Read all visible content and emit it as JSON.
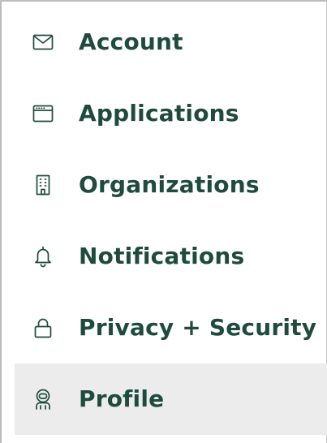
{
  "menu": {
    "items": [
      {
        "label": "Account",
        "icon": "mail-icon",
        "active": false
      },
      {
        "label": "Applications",
        "icon": "browser-window-icon",
        "active": false
      },
      {
        "label": "Organizations",
        "icon": "building-icon",
        "active": false
      },
      {
        "label": "Notifications",
        "icon": "bell-icon",
        "active": false
      },
      {
        "label": "Privacy + Security",
        "icon": "lock-icon",
        "active": false
      },
      {
        "label": "Profile",
        "icon": "astronaut-avatar-icon",
        "active": true
      }
    ]
  },
  "colors": {
    "text": "#1f4b3f",
    "active_background": "#ececec",
    "frame_border": "#bdbdbd"
  }
}
